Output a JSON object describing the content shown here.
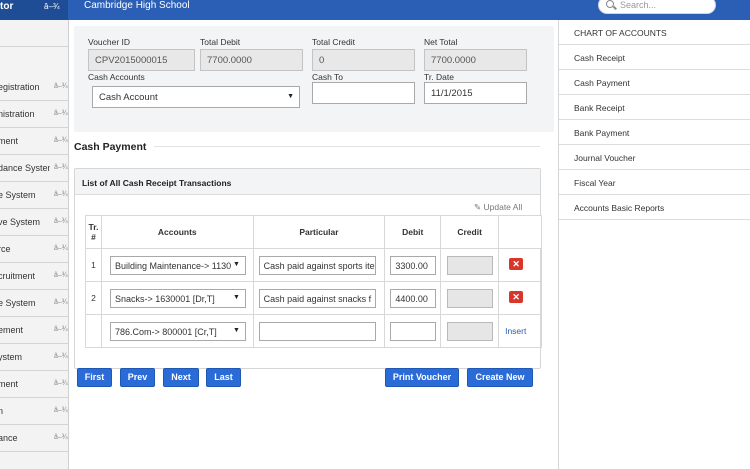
{
  "topbar": {
    "brand": "tor",
    "brand_glyph": "â–¾",
    "school_name": "Cambridge High School",
    "search_placeholder": "Search..."
  },
  "sidebar": {
    "items": [
      {
        "label": "egistration",
        "glyph": "â–¾"
      },
      {
        "label": "nistration",
        "glyph": "â–¾"
      },
      {
        "label": "ment",
        "glyph": "â–¾"
      },
      {
        "label": "dance Systen",
        "glyph": "â–¾"
      },
      {
        "label": "e System",
        "glyph": "â–¾"
      },
      {
        "label": "ve System",
        "glyph": "â–¾"
      },
      {
        "label": "rce",
        "glyph": "â–¾"
      },
      {
        "label": "cruitment",
        "glyph": "â–¾"
      },
      {
        "label": "e System",
        "glyph": "â–¾"
      },
      {
        "label": "ement",
        "glyph": "â–¾"
      },
      {
        "label": "ystem",
        "glyph": "â–¾"
      },
      {
        "label": "ment",
        "glyph": "â–¾"
      },
      {
        "label": "n",
        "glyph": "â–¾"
      },
      {
        "label": "ance",
        "glyph": "â–¾"
      }
    ]
  },
  "form": {
    "voucher_id_label": "Voucher ID",
    "voucher_id": "CPV2015000015",
    "total_debit_label": "Total Debit",
    "total_debit": "7700.0000",
    "total_credit_label": "Total Credit",
    "total_credit": "0",
    "net_total_label": "Net Total",
    "net_total": "7700.0000",
    "cash_accounts_label": "Cash Accounts",
    "cash_accounts_value": "Cash Account",
    "cash_to_label": "Cash To",
    "cash_to_value": "",
    "tr_date_label": "Tr. Date",
    "tr_date_value": "11/1/2015"
  },
  "section_title": "Cash Payment",
  "transactions": {
    "heading": "List of All Cash Receipt Transactions",
    "update_all": "Update All",
    "columns": {
      "tr": "Tr. #",
      "accounts": "Accounts",
      "particular": "Particular",
      "debit": "Debit",
      "credit": "Credit"
    },
    "rows": [
      {
        "tr": "1",
        "account": "Building Maintenance-> 1130",
        "particular": "Cash paid against sports ite",
        "debit": "3300.00",
        "credit": ""
      },
      {
        "tr": "2",
        "account": "Snacks-> 1630001 [Dr,T]",
        "particular": "Cash paid against snacks f",
        "debit": "4400.00",
        "credit": ""
      }
    ],
    "new_row": {
      "account": "786.Com-> 800001 [Cr,T]",
      "particular": "",
      "debit": "",
      "credit": "",
      "insert": "Insert"
    }
  },
  "buttons": {
    "first": "First",
    "prev": "Prev",
    "next": "Next",
    "last": "Last",
    "print": "Print Voucher",
    "create": "Create New"
  },
  "right_panel": {
    "title": "CHART OF ACCOUNTS",
    "items": [
      "Cash Receipt",
      "Cash Payment",
      "Bank Receipt",
      "Bank Payment",
      "Journal Voucher",
      "Fiscal Year",
      "Accounts Basic Reports"
    ]
  }
}
